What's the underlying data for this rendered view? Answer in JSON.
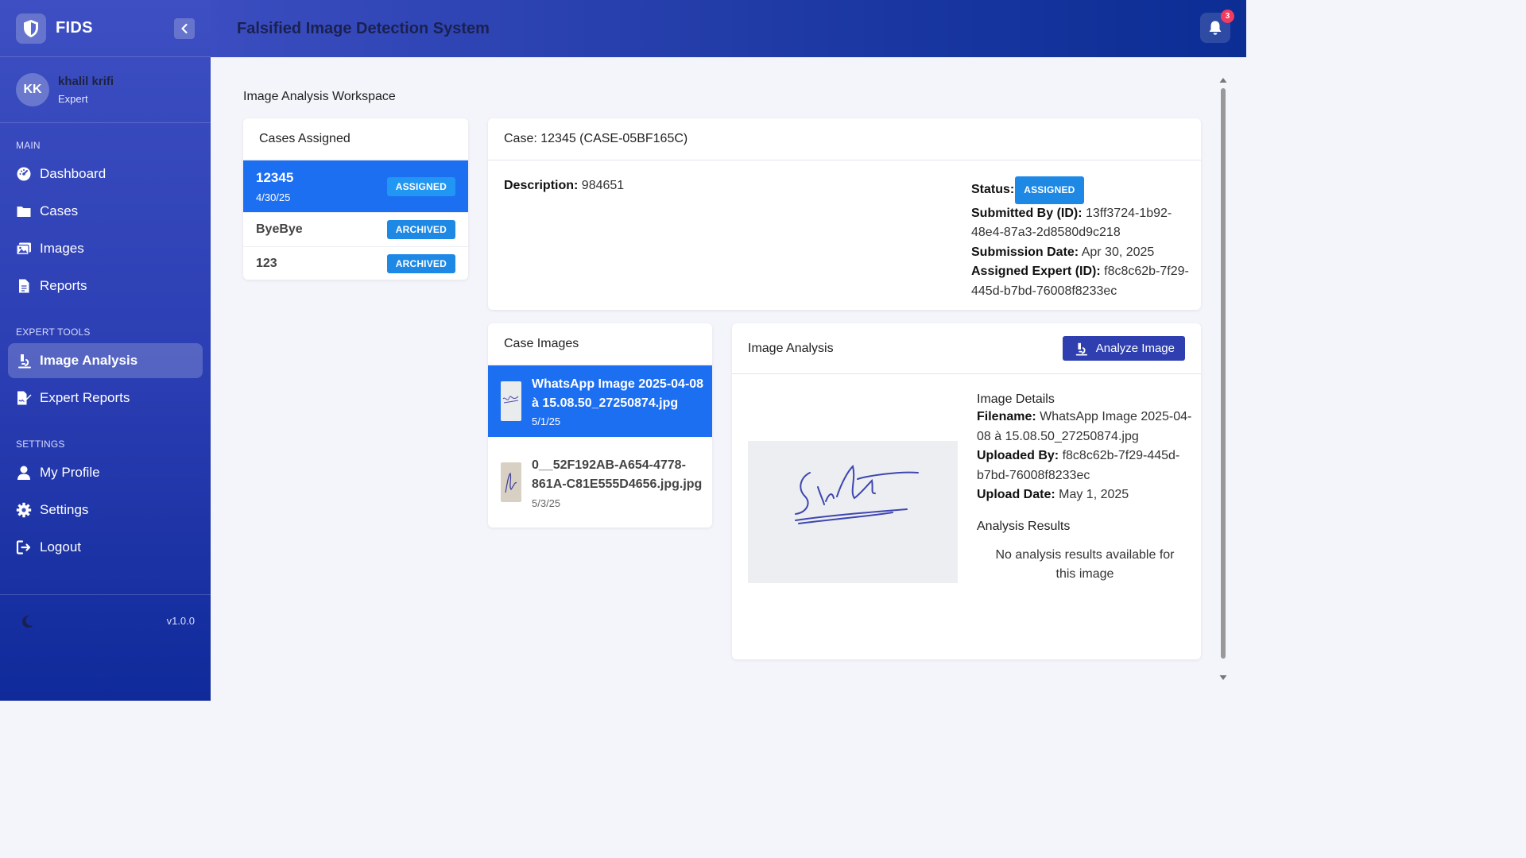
{
  "brand": {
    "name": "FIDS"
  },
  "user": {
    "initials": "KK",
    "name": "khalil krifi",
    "role": "Expert"
  },
  "nav": {
    "main_label": "MAIN",
    "main": [
      {
        "label": "Dashboard"
      },
      {
        "label": "Cases"
      },
      {
        "label": "Images"
      },
      {
        "label": "Reports"
      }
    ],
    "tools_label": "EXPERT TOOLS",
    "tools": [
      {
        "label": "Image Analysis"
      },
      {
        "label": "Expert Reports"
      }
    ],
    "settings_label": "SETTINGS",
    "settings": [
      {
        "label": "My Profile"
      },
      {
        "label": "Settings"
      },
      {
        "label": "Logout"
      }
    ]
  },
  "version": "v1.0.0",
  "header": {
    "title": "Falsified Image Detection System",
    "notification_count": "3"
  },
  "workspace_title": "Image Analysis Workspace",
  "cases": {
    "title": "Cases Assigned",
    "items": [
      {
        "name": "12345",
        "date": "4/30/25",
        "status": "ASSIGNED"
      },
      {
        "name": "ByeBye",
        "status": "ARCHIVED"
      },
      {
        "name": "123",
        "status": "ARCHIVED"
      }
    ]
  },
  "case_detail": {
    "title": "Case: 12345 (CASE-05BF165C)",
    "description_label": "Description:",
    "description": "984651",
    "status_label": "Status:",
    "status": "ASSIGNED",
    "submitted_by_label": "Submitted By (ID):",
    "submitted_by": "13ff3724-1b92-48e4-87a3-2d8580d9c218",
    "submission_date_label": "Submission Date:",
    "submission_date": "Apr 30, 2025",
    "assigned_expert_label": "Assigned Expert (ID):",
    "assigned_expert": "f8c8c62b-7f29-445d-b7bd-76008f8233ec"
  },
  "case_images": {
    "title": "Case Images",
    "items": [
      {
        "name": "WhatsApp Image 2025-04-08 à 15.08.50_27250874.jpg",
        "date": "5/1/25"
      },
      {
        "name": "0__52F192AB-A654-4778-861A-C81E555D4656.jpg.jpg",
        "date": "5/3/25"
      }
    ]
  },
  "analysis": {
    "title": "Image Analysis",
    "analyze_button": "Analyze Image",
    "details_title": "Image Details",
    "filename_label": "Filename:",
    "filename": "WhatsApp Image 2025-04-08 à 15.08.50_27250874.jpg",
    "uploaded_by_label": "Uploaded By:",
    "uploaded_by": "f8c8c62b-7f29-445d-b7bd-76008f8233ec",
    "upload_date_label": "Upload Date:",
    "upload_date": "May 1, 2025",
    "results_title": "Analysis Results",
    "no_results": "No analysis results available for this image"
  },
  "colors": {
    "accent": "#1d6ff2",
    "status_badge": "#1e88e5",
    "analyze_button": "#2f3fb0",
    "sidebar": "#2a3db2"
  }
}
